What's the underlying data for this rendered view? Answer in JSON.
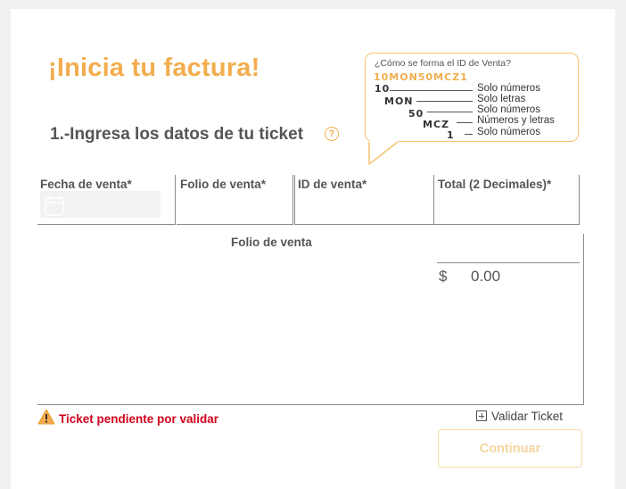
{
  "header": {
    "title": "¡Inicia tu factura!",
    "step_title": "1.-Ingresa los datos de tu ticket",
    "help_icon_glyph": "?"
  },
  "tooltip": {
    "title": "¿Cómo se forma el ID de Venta?",
    "example_code": "10MON50MCZ1",
    "segments": [
      {
        "code": "10",
        "description": "Solo números"
      },
      {
        "code": "MON",
        "description": "Solo letras"
      },
      {
        "code": "50",
        "description": "Solo números"
      },
      {
        "code": "MCZ",
        "description": "Números y letras"
      },
      {
        "code": "1",
        "description": "Solo números"
      }
    ]
  },
  "form": {
    "columns": [
      "Fecha de venta*",
      "Folio de venta*",
      "ID de venta*",
      "Total (2 Decimales)*"
    ],
    "fecha_value": "",
    "folio_value": "",
    "id_value": "",
    "total_value": ""
  },
  "summary": {
    "folio_header": "Folio de venta",
    "currency_symbol": "$",
    "total": "0.00"
  },
  "status": {
    "pending_text": "Ticket pendiente por validar"
  },
  "actions": {
    "validate_label": "Validar Ticket",
    "continue_label": "Continuar"
  },
  "colors": {
    "accent": "#f2ad4e",
    "error": "#d0021b",
    "text": "#555555"
  }
}
